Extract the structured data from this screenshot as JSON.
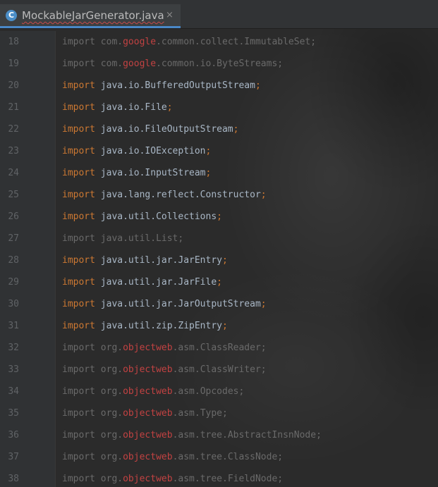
{
  "tab": {
    "icon_letter": "C",
    "title": "MockableJarGenerator.java",
    "close": "×"
  },
  "colors": {
    "keyword": "#cc7832",
    "identifier": "#a9b7c6",
    "unresolved": "#d04a4a",
    "unused": "#6a6a6a",
    "line_number": "#606366"
  },
  "lines": [
    {
      "num": "18",
      "kw": "import",
      "pre": "com.",
      "hl": "google",
      "post": ".common.collect.ImmutableSet",
      "semi": ";",
      "unused": true
    },
    {
      "num": "19",
      "kw": "import",
      "pre": "com.",
      "hl": "google",
      "post": ".common.io.ByteStreams",
      "semi": ";",
      "unused": true
    },
    {
      "num": "20",
      "kw": "import",
      "pre": "java.io.BufferedOutputStream",
      "hl": "",
      "post": "",
      "semi": ";",
      "unused": false
    },
    {
      "num": "21",
      "kw": "import",
      "pre": "java.io.File",
      "hl": "",
      "post": "",
      "semi": ";",
      "unused": false
    },
    {
      "num": "22",
      "kw": "import",
      "pre": "java.io.FileOutputStream",
      "hl": "",
      "post": "",
      "semi": ";",
      "unused": false
    },
    {
      "num": "23",
      "kw": "import",
      "pre": "java.io.IOException",
      "hl": "",
      "post": "",
      "semi": ";",
      "unused": false
    },
    {
      "num": "24",
      "kw": "import",
      "pre": "java.io.InputStream",
      "hl": "",
      "post": "",
      "semi": ";",
      "unused": false
    },
    {
      "num": "25",
      "kw": "import",
      "pre": "java.lang.reflect.Constructor",
      "hl": "",
      "post": "",
      "semi": ";",
      "unused": false
    },
    {
      "num": "26",
      "kw": "import",
      "pre": "java.util.Collections",
      "hl": "",
      "post": "",
      "semi": ";",
      "unused": false
    },
    {
      "num": "27",
      "kw": "import",
      "pre": "java.util.List",
      "hl": "",
      "post": "",
      "semi": ";",
      "unused": true
    },
    {
      "num": "28",
      "kw": "import",
      "pre": "java.util.jar.JarEntry",
      "hl": "",
      "post": "",
      "semi": ";",
      "unused": false
    },
    {
      "num": "29",
      "kw": "import",
      "pre": "java.util.jar.JarFile",
      "hl": "",
      "post": "",
      "semi": ";",
      "unused": false
    },
    {
      "num": "30",
      "kw": "import",
      "pre": "java.util.jar.JarOutputStream",
      "hl": "",
      "post": "",
      "semi": ";",
      "unused": false
    },
    {
      "num": "31",
      "kw": "import",
      "pre": "java.util.zip.ZipEntry",
      "hl": "",
      "post": "",
      "semi": ";",
      "unused": false
    },
    {
      "num": "32",
      "kw": "import",
      "pre": "org.",
      "hl": "objectweb",
      "post": ".asm.ClassReader",
      "semi": ";",
      "unused": true
    },
    {
      "num": "33",
      "kw": "import",
      "pre": "org.",
      "hl": "objectweb",
      "post": ".asm.ClassWriter",
      "semi": ";",
      "unused": true
    },
    {
      "num": "34",
      "kw": "import",
      "pre": "org.",
      "hl": "objectweb",
      "post": ".asm.Opcodes",
      "semi": ";",
      "unused": true
    },
    {
      "num": "35",
      "kw": "import",
      "pre": "org.",
      "hl": "objectweb",
      "post": ".asm.Type",
      "semi": ";",
      "unused": true
    },
    {
      "num": "36",
      "kw": "import",
      "pre": "org.",
      "hl": "objectweb",
      "post": ".asm.tree.AbstractInsnNode",
      "semi": ";",
      "unused": true
    },
    {
      "num": "37",
      "kw": "import",
      "pre": "org.",
      "hl": "objectweb",
      "post": ".asm.tree.ClassNode",
      "semi": ";",
      "unused": true
    },
    {
      "num": "38",
      "kw": "import",
      "pre": "org.",
      "hl": "objectweb",
      "post": ".asm.tree.FieldNode",
      "semi": ";",
      "unused": true
    }
  ]
}
